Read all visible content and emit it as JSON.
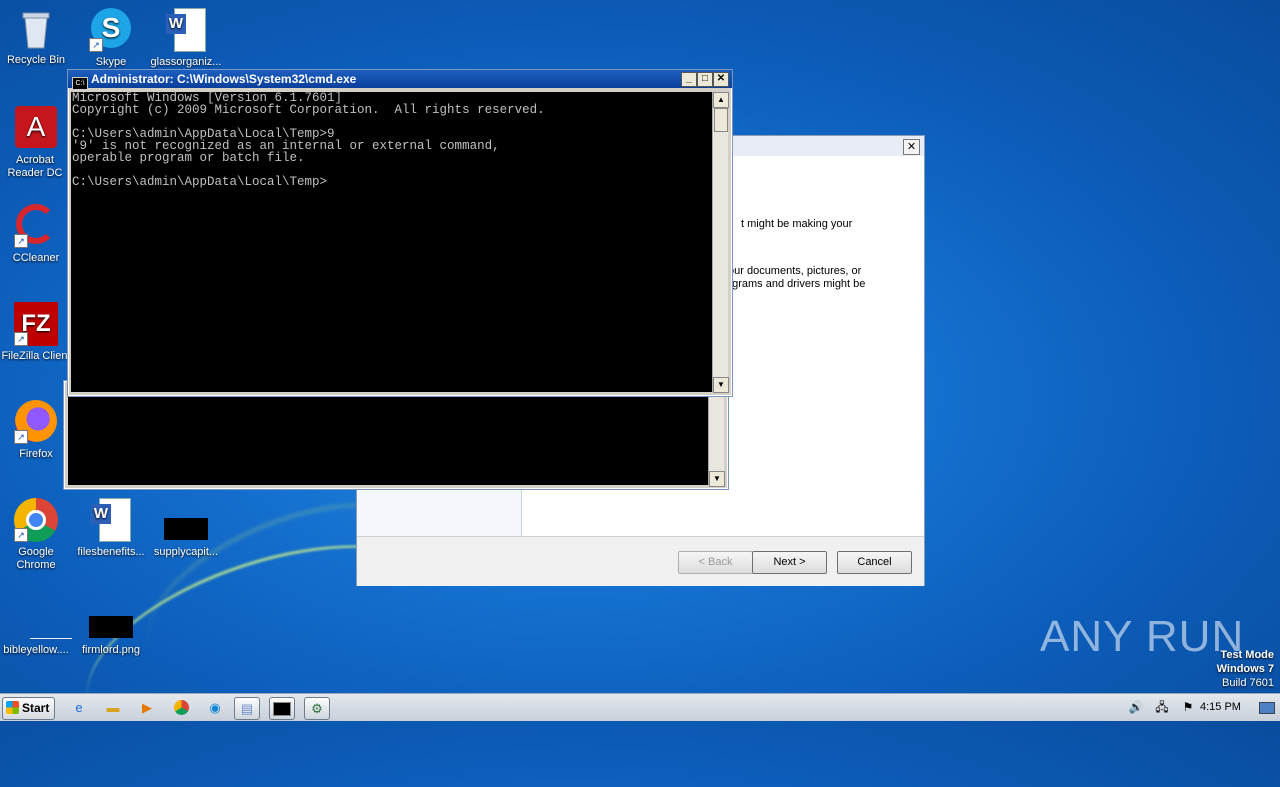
{
  "desktop": {
    "icons": [
      {
        "label": "Recycle Bin",
        "glyph": "🗑",
        "icon": "recycle-bin-icon"
      },
      {
        "label": "Skype",
        "glyph": "S",
        "icon": "skype-icon"
      },
      {
        "label": "glassorganiz...",
        "glyph": "W",
        "icon": "word-doc-icon"
      },
      {
        "label": "Acrobat Reader DC",
        "glyph": "A",
        "icon": "acrobat-icon"
      },
      {
        "label": "CCleaner",
        "glyph": "C",
        "icon": "ccleaner-icon"
      },
      {
        "label": "FileZilla Client",
        "glyph": "FZ",
        "icon": "filezilla-icon"
      },
      {
        "label": "Firefox",
        "glyph": "🦊",
        "icon": "firefox-icon"
      },
      {
        "label": "Google Chrome",
        "glyph": "",
        "icon": "chrome-icon"
      },
      {
        "label": "filesbenefits...",
        "glyph": "W",
        "icon": "word-doc-icon"
      },
      {
        "label": "supplycapit...",
        "glyph": "",
        "icon": "black-file-icon"
      },
      {
        "label": "bibleyellow....",
        "glyph": "",
        "icon": "blank-file-icon"
      },
      {
        "label": "firmlord.png",
        "glyph": "",
        "icon": "black-file-icon"
      }
    ]
  },
  "cmd_front": {
    "title": "Administrator: C:\\Windows\\System32\\cmd.exe",
    "output": "Microsoft Windows [Version 6.1.7601]\nCopyright (c) 2009 Microsoft Corporation.  All rights reserved.\n\nC:\\Users\\admin\\AppData\\Local\\Temp>9\n'9' is not recognized as an internal or external command,\noperable program or batch file.\n\nC:\\Users\\admin\\AppData\\Local\\Temp>"
  },
  "wizard": {
    "text1": "t might be making your",
    "text2": "our documents, pictures, or",
    "text3": "ograms and drivers might be",
    "back_label": "< Back",
    "next_label": "Next >",
    "cancel_label": "Cancel"
  },
  "watermark": {
    "brand": "ANY RUN",
    "testmode_line1": "Test Mode",
    "testmode_line2": "Windows 7",
    "testmode_line3": "Build 7601"
  },
  "taskbar": {
    "start_label": "Start",
    "clock": "4:15 PM"
  }
}
